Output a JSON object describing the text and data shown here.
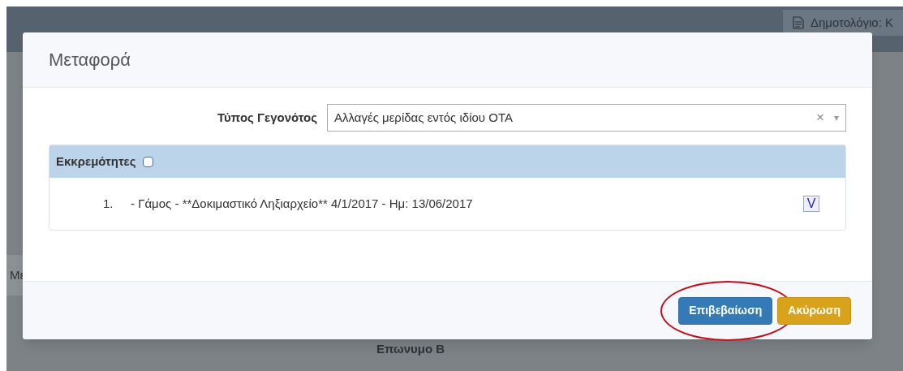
{
  "background": {
    "header_text": "Δημοτολόγιο: Κ",
    "side_label": "Με",
    "field_label": "Επωνυμο Β"
  },
  "dialog": {
    "title": "Μεταφορά",
    "event_type": {
      "label": "Τύπος Γεγονότος",
      "value": "Αλλαγές μερίδας εντός ιδίου ΟΤΑ",
      "clear": "×",
      "caret": "▾"
    },
    "pending": {
      "title": "Εκκρεμότητες",
      "checked": false,
      "items": [
        {
          "number": "1.",
          "text": "- Γάμος - **Δοκιμαστικό Ληξιαρχείο** 4/1/2017 - Ημ: 13/06/2017",
          "mark": "V",
          "checked": true
        }
      ]
    },
    "buttons": [
      {
        "kind": "primary",
        "label": "Επιβεβαίωση",
        "highlighted": true
      },
      {
        "kind": "warning",
        "label": "Ακύρωση",
        "highlighted": false
      }
    ]
  }
}
